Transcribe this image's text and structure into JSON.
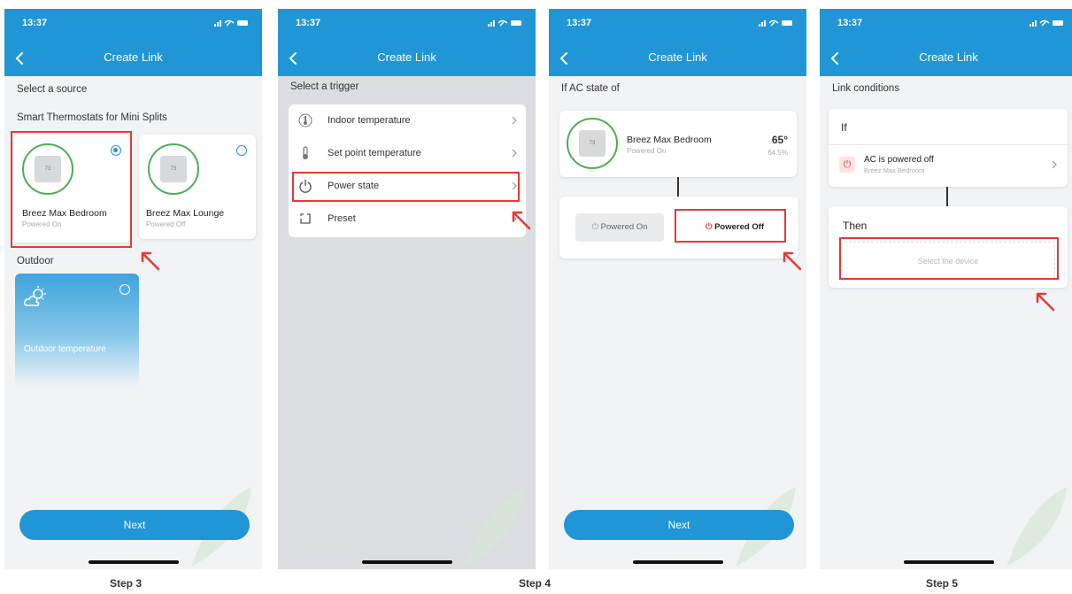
{
  "status_time": "13:37",
  "nav_title": "Create Link",
  "screen1": {
    "heading": "Select a source",
    "group_title": "Smart Thermostats for Mini Splits",
    "devices": [
      {
        "name": "Breez Max Bedroom",
        "status": "Powered On",
        "selected": true,
        "screen": "73"
      },
      {
        "name": "Breez Max Lounge",
        "status": "Powered Off",
        "selected": false,
        "screen": "73"
      }
    ],
    "outdoor_title": "Outdoor",
    "outdoor_card_label": "Outdoor temperature",
    "next_label": "Next"
  },
  "screen2": {
    "heading": "Select a trigger",
    "triggers": [
      {
        "label": "Indoor temperature",
        "icon": "thermometer-icon"
      },
      {
        "label": "Set point temperature",
        "icon": "thermostat-setpoint-icon"
      },
      {
        "label": "Power state",
        "icon": "power-icon"
      },
      {
        "label": "Preset",
        "icon": "preset-icon"
      }
    ]
  },
  "screen3": {
    "heading": "If AC state of",
    "device_name": "Breez Max Bedroom",
    "device_status": "Powered On",
    "device_screen": "73",
    "temperature": "65°",
    "humidity": "64.5%",
    "option_on": "Powered On",
    "option_off": "Powered Off",
    "next_label": "Next"
  },
  "screen4": {
    "heading": "Link conditions",
    "if_title": "If",
    "condition_title": "AC is powered off",
    "condition_device": "Breez Max Bedroom",
    "then_title": "Then",
    "select_device_label": "Select the device"
  },
  "step_labels": [
    "Step 3",
    "Step 4",
    "Step 5"
  ],
  "colors": {
    "primary": "#2196d6",
    "highlight": "#e53935",
    "ring": "#4caf50"
  }
}
